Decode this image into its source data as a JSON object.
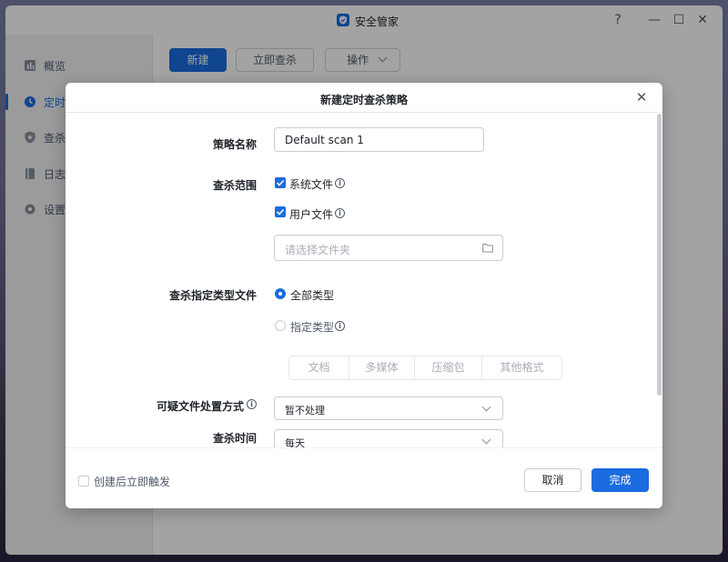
{
  "window": {
    "title": "安全管家"
  },
  "window_controls": {
    "help": "?",
    "minimize": "—",
    "maximize": "☐",
    "close": "✕"
  },
  "sidebar": {
    "items": [
      {
        "label": "概览",
        "icon": "chart-icon",
        "active": false
      },
      {
        "label": "定时",
        "icon": "clock-icon",
        "active": true
      },
      {
        "label": "查杀",
        "icon": "shield-icon",
        "active": false
      },
      {
        "label": "日志",
        "icon": "log-icon",
        "active": false
      },
      {
        "label": "设置",
        "icon": "gear-icon",
        "active": false
      }
    ]
  },
  "toolbar": {
    "new_label": "新建",
    "scan_now_label": "立即查杀",
    "ops_label": "操作"
  },
  "dialog": {
    "title": "新建定时查杀策略",
    "close": "✕",
    "policy_name": {
      "label": "策略名称",
      "value": "Default scan 1"
    },
    "scan_scope": {
      "label": "查杀范围",
      "system_files": {
        "label": "系统文件",
        "checked": true
      },
      "user_files": {
        "label": "用户文件",
        "checked": true
      },
      "folder_placeholder": "请选择文件夹"
    },
    "file_types": {
      "label": "查杀指定类型文件",
      "all_types": {
        "label": "全部类型",
        "selected": true
      },
      "specified_types": {
        "label": "指定类型",
        "selected": false
      },
      "segments": [
        "文档",
        "多媒体",
        "压缩包",
        "其他格式"
      ]
    },
    "suspicious_handling": {
      "label": "可疑文件处置方式",
      "value": "暂不处理"
    },
    "scan_time": {
      "label": "查杀时间",
      "value": "每天"
    },
    "footer": {
      "trigger_after_create": {
        "label": "创建后立即触发",
        "checked": false
      },
      "cancel_label": "取消",
      "done_label": "完成"
    }
  },
  "colors": {
    "accent": "#1a6ce0",
    "border": "#c9cdd4",
    "text": "#1f2329",
    "muted": "#a9aeb8"
  }
}
